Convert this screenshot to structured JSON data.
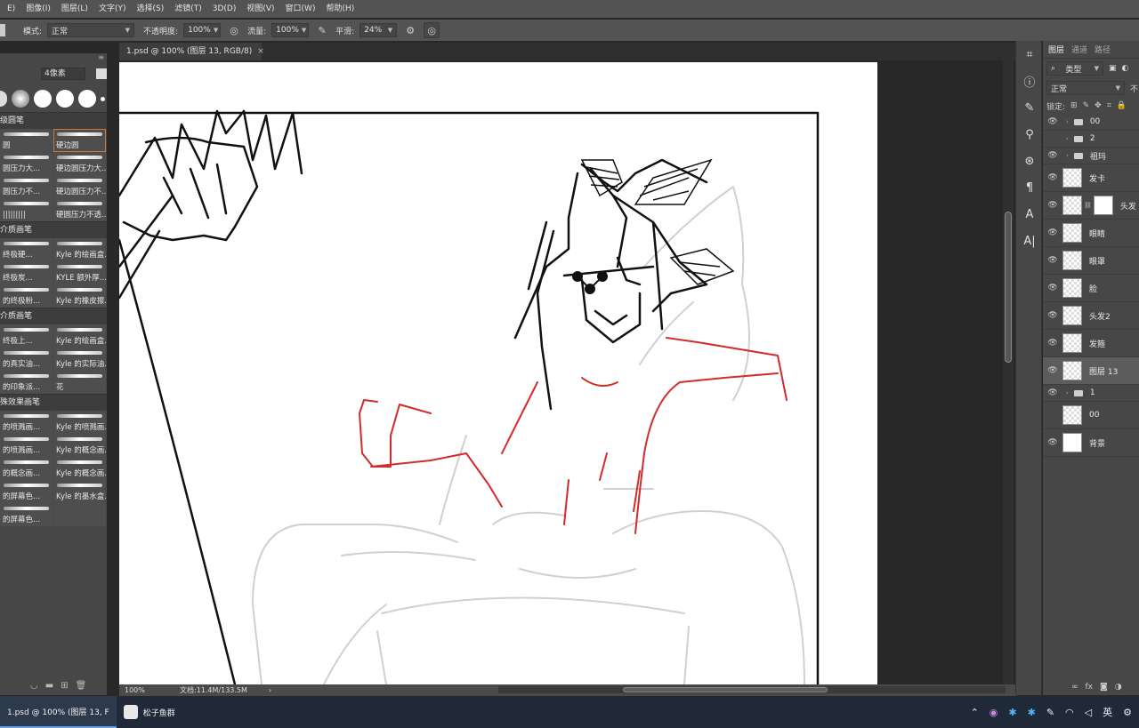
{
  "menu": [
    "E)",
    "图像(I)",
    "图层(L)",
    "文字(Y)",
    "选择(S)",
    "滤镜(T)",
    "3D(D)",
    "视图(V)",
    "窗口(W)",
    "帮助(H)"
  ],
  "options": {
    "mode_label": "模式:",
    "mode_value": "正常",
    "opacity_label": "不透明度:",
    "opacity_value": "100%",
    "flow_label": "流量:",
    "flow_value": "100%",
    "smooth_label": "平滑:",
    "smooth_value": "24%"
  },
  "brushes": {
    "size_value": "4像素",
    "sections": [
      {
        "title": "级圆笔",
        "rows": [
          [
            "圆",
            "硬边圆"
          ],
          [
            "圆压力大...",
            "硬边圆压力大..."
          ],
          [
            "圆压力不...",
            "硬边圆压力不..."
          ],
          [
            "|||||||||",
            "硬圆压力不透..."
          ]
        ]
      },
      {
        "title": "介质画笔",
        "rows": [
          [
            "终极硬...",
            "Kyle 的绘画盒..."
          ],
          [
            "终极炭...",
            "KYLE 额外厚..."
          ],
          [
            "的终极粉...",
            "Kyle 的橡皮擦..."
          ]
        ]
      },
      {
        "title": "介质画笔",
        "rows": [
          [
            "终极上...",
            "Kyle 的绘画盒..."
          ],
          [
            "的真实油...",
            "Kyle 的实际油..."
          ],
          [
            "的印象派...",
            "花"
          ]
        ]
      },
      {
        "title": "殊效果画笔",
        "rows": [
          [
            "的喷溅画...",
            "Kyle 的喷溅画..."
          ],
          [
            "的喷溅画...",
            "Kyle 的概念画..."
          ],
          [
            "的概念画...",
            "Kyle 的概念画..."
          ],
          [
            "的屏幕色...",
            "Kyle 的墨水盒..."
          ],
          [
            "的屏幕色...",
            ""
          ]
        ]
      }
    ]
  },
  "document": {
    "tab_title": "1.psd @ 100% (图层 13, RGB/8)",
    "tab_close": "×",
    "zoom": "100%",
    "doc_info": "文档:11.4M/133.5M"
  },
  "layers_panel": {
    "tabs": [
      "图层",
      "通道",
      "路径"
    ],
    "filter_label": "类型",
    "blend_mode": "正常",
    "opacity_cut": "不",
    "lock_label": "锁定:",
    "layers": [
      {
        "name": "00",
        "kind": "group",
        "visible": true
      },
      {
        "name": "2",
        "kind": "group",
        "visible": false
      },
      {
        "name": "祖玛",
        "kind": "group",
        "visible": true
      },
      {
        "name": "发卡",
        "kind": "layer",
        "visible": true
      },
      {
        "name": "头发",
        "kind": "layer-mask",
        "visible": true
      },
      {
        "name": "眼睛",
        "kind": "layer",
        "visible": true
      },
      {
        "name": "眼罩",
        "kind": "layer",
        "visible": true
      },
      {
        "name": "脸",
        "kind": "layer",
        "visible": true
      },
      {
        "name": "头发2",
        "kind": "layer",
        "visible": true
      },
      {
        "name": "发箍",
        "kind": "layer",
        "visible": true
      },
      {
        "name": "图层 13",
        "kind": "layer",
        "visible": true,
        "active": true
      },
      {
        "name": "1",
        "kind": "group",
        "visible": true
      },
      {
        "name": "00",
        "kind": "layer",
        "visible": false
      },
      {
        "name": "背景",
        "kind": "background",
        "visible": true
      }
    ]
  },
  "taskbar": {
    "app1": "1.psd @ 100% (图层 13, F",
    "app2": "松子鱼群",
    "ime": "英"
  },
  "colors": {
    "accent": "#c9783c",
    "red_line": "#d42a2a"
  }
}
